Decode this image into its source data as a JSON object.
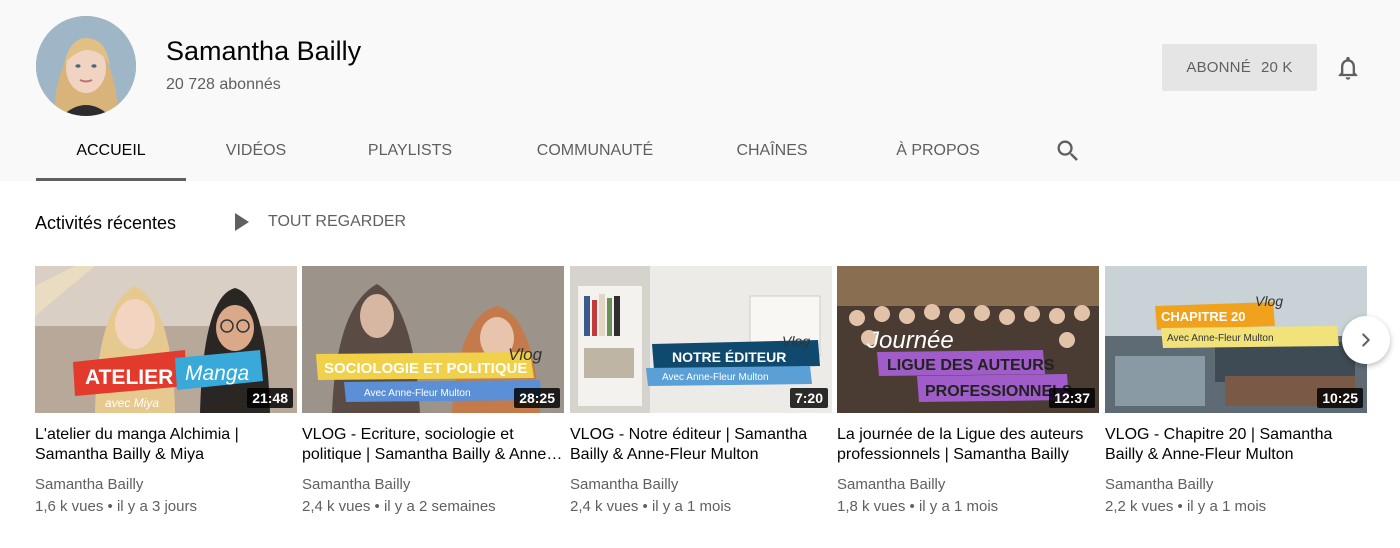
{
  "channel": {
    "name": "Samantha Bailly",
    "subscribers": "20 728 abonnés",
    "subscribe_label": "ABONNÉ",
    "subscribe_count": "20 K"
  },
  "tabs": [
    {
      "label": "ACCUEIL",
      "active": true
    },
    {
      "label": "VIDÉOS"
    },
    {
      "label": "PLAYLISTS"
    },
    {
      "label": "COMMUNAUTÉ"
    },
    {
      "label": "CHAÎNES"
    },
    {
      "label": "À PROPOS"
    }
  ],
  "section": {
    "title": "Activités récentes",
    "play_all": "TOUT REGARDER"
  },
  "videos": [
    {
      "title": "L'atelier du manga Alchimia | Samantha Bailly & Miya",
      "channel": "Samantha Bailly",
      "meta": "1,6 k vues • il y a 3 jours",
      "duration": "21:48",
      "thumb_text": [
        "ATELIER",
        "Manga",
        "avec Miya"
      ]
    },
    {
      "title": "VLOG - Ecriture, sociologie et politique | Samantha Bailly & Anne-Fleur Multon",
      "channel": "Samantha Bailly",
      "meta": "2,4 k vues • il y a 2 semaines",
      "duration": "28:25",
      "thumb_text": [
        "SOCIOLOGIE ET POLITIQUE",
        "Vlog",
        "Avec Anne-Fleur Multon"
      ]
    },
    {
      "title": "VLOG - Notre éditeur | Samantha Bailly & Anne-Fleur Multon",
      "channel": "Samantha Bailly",
      "meta": "2,4 k vues • il y a 1 mois",
      "duration": "7:20",
      "thumb_text": [
        "NOTRE ÉDITEUR",
        "Vlog",
        "Avec Anne-Fleur Multon"
      ]
    },
    {
      "title": "La journée de la Ligue des auteurs professionnels | Samantha Bailly",
      "channel": "Samantha Bailly",
      "meta": "1,8 k vues • il y a 1 mois",
      "duration": "12:37",
      "thumb_text": [
        "Journée",
        "LIGUE DES AUTEURS",
        "PROFESSIONNELS"
      ]
    },
    {
      "title": "VLOG - Chapitre 20 | Samantha Bailly & Anne-Fleur Multon",
      "channel": "Samantha Bailly",
      "meta": "2,2 k vues • il y a 1 mois",
      "duration": "10:25",
      "thumb_text": [
        "CHAPITRE 20",
        "Vlog",
        "Avec Anne-Fleur Multon"
      ]
    }
  ],
  "icons": {
    "bell": "bell-icon",
    "search": "search-icon",
    "play": "play-icon",
    "next": "chevron-right-icon"
  },
  "colors": {
    "header_bg": "#f9f9f9",
    "secondary_text": "#606060",
    "subscribe_bg": "#e5e5e5"
  }
}
